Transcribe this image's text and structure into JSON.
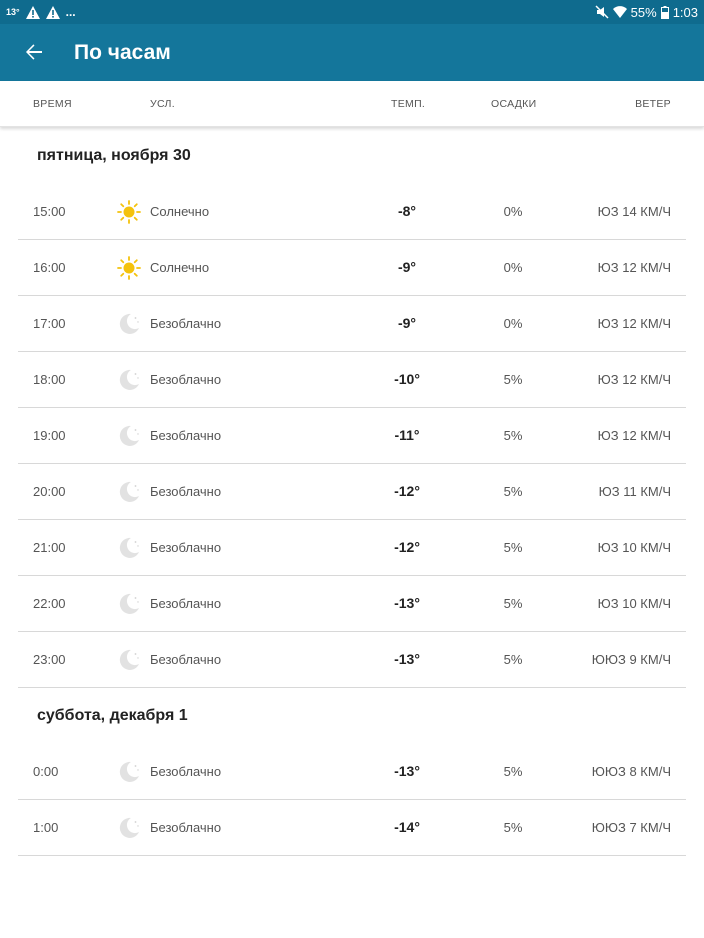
{
  "statusbar": {
    "temp": "13°",
    "ellipsis": "...",
    "battery": "55%",
    "time": "1:03"
  },
  "appbar": {
    "title": "По часам",
    "background": "#14769b"
  },
  "columns": {
    "time": "ВРЕМЯ",
    "cond": "УСЛ.",
    "temp": "ТЕМП.",
    "precip": "ОСАДКИ",
    "wind": "ВЕТЕР"
  },
  "days": [
    {
      "title": "пятница, ноября 30",
      "rows": [
        {
          "time": "15:00",
          "icon": "sun-icon",
          "cond": "Солнечно",
          "temp": "-8°",
          "precip": "0%",
          "wind": "ЮЗ 14 КМ/Ч"
        },
        {
          "time": "16:00",
          "icon": "sun-icon",
          "cond": "Солнечно",
          "temp": "-9°",
          "precip": "0%",
          "wind": "ЮЗ 12 КМ/Ч"
        },
        {
          "time": "17:00",
          "icon": "moon-icon",
          "cond": "Безоблачно",
          "temp": "-9°",
          "precip": "0%",
          "wind": "ЮЗ 12 КМ/Ч"
        },
        {
          "time": "18:00",
          "icon": "moon-icon",
          "cond": "Безоблачно",
          "temp": "-10°",
          "precip": "5%",
          "wind": "ЮЗ 12 КМ/Ч"
        },
        {
          "time": "19:00",
          "icon": "moon-icon",
          "cond": "Безоблачно",
          "temp": "-11°",
          "precip": "5%",
          "wind": "ЮЗ 12 КМ/Ч"
        },
        {
          "time": "20:00",
          "icon": "moon-icon",
          "cond": "Безоблачно",
          "temp": "-12°",
          "precip": "5%",
          "wind": "ЮЗ 11 КМ/Ч"
        },
        {
          "time": "21:00",
          "icon": "moon-icon",
          "cond": "Безоблачно",
          "temp": "-12°",
          "precip": "5%",
          "wind": "ЮЗ 10 КМ/Ч"
        },
        {
          "time": "22:00",
          "icon": "moon-icon",
          "cond": "Безоблачно",
          "temp": "-13°",
          "precip": "5%",
          "wind": "ЮЗ 10 КМ/Ч"
        },
        {
          "time": "23:00",
          "icon": "moon-icon",
          "cond": "Безоблачно",
          "temp": "-13°",
          "precip": "5%",
          "wind": "ЮЮЗ 9 КМ/Ч"
        }
      ]
    },
    {
      "title": "суббота, декабря 1",
      "rows": [
        {
          "time": "0:00",
          "icon": "moon-icon",
          "cond": "Безоблачно",
          "temp": "-13°",
          "precip": "5%",
          "wind": "ЮЮЗ 8 КМ/Ч"
        },
        {
          "time": "1:00",
          "icon": "moon-icon",
          "cond": "Безоблачно",
          "temp": "-14°",
          "precip": "5%",
          "wind": "ЮЮЗ 7 КМ/Ч"
        }
      ]
    }
  ]
}
